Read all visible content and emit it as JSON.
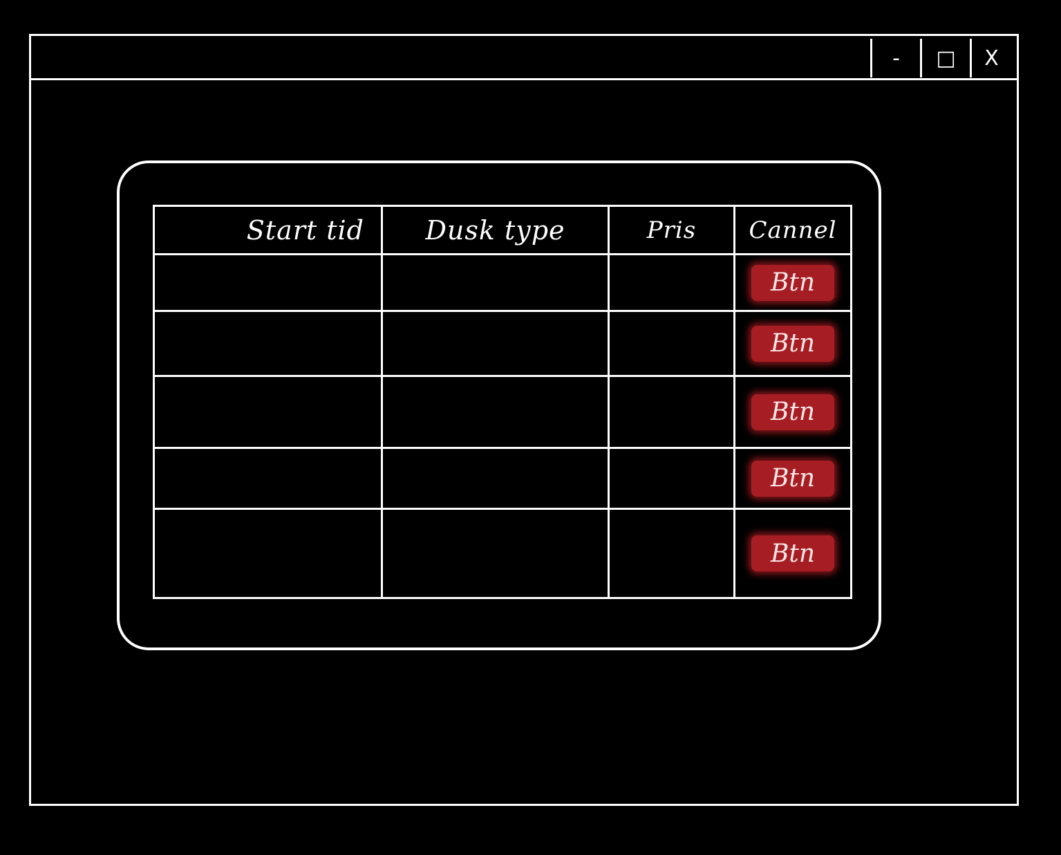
{
  "window": {
    "controls": {
      "minimize_label": "-",
      "maximize_label": "□",
      "close_label": "X"
    }
  },
  "table": {
    "columns": [
      "Start tid",
      "Dusk type",
      "Pris",
      "Cannel"
    ],
    "rows": [
      {
        "cells": [
          "",
          "",
          ""
        ],
        "action_label": "Btn"
      },
      {
        "cells": [
          "",
          "",
          ""
        ],
        "action_label": "Btn"
      },
      {
        "cells": [
          "",
          "",
          ""
        ],
        "action_label": "Btn"
      },
      {
        "cells": [
          "",
          "",
          ""
        ],
        "action_label": "Btn"
      },
      {
        "cells": [
          "",
          "",
          ""
        ],
        "action_label": "Btn"
      }
    ]
  },
  "colors": {
    "background": "#000000",
    "line": "#ffffff",
    "button": "#a61e24"
  }
}
